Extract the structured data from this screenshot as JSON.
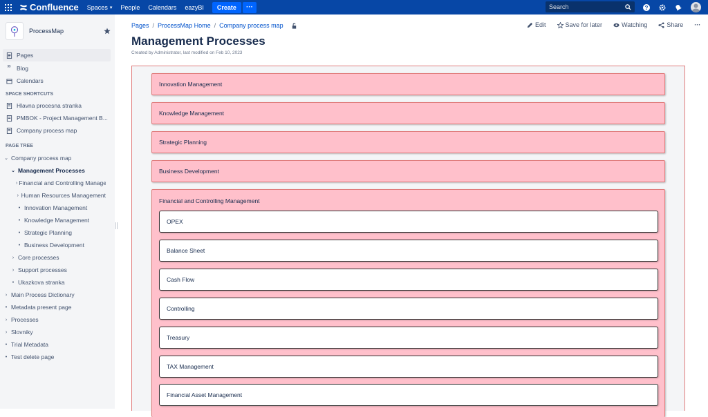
{
  "topnav": {
    "brand": "Confluence",
    "items": [
      "Spaces",
      "People",
      "Calendars",
      "eazyBI"
    ],
    "create_label": "Create",
    "more_label": "···",
    "search_placeholder": "Search"
  },
  "sidebar": {
    "space_name": "ProcessMap",
    "nav": [
      "Pages",
      "Blog",
      "Calendars"
    ],
    "shortcuts_header": "SPACE SHORTCUTS",
    "shortcuts": [
      "Hlavna procesna stranka",
      "PMBOK - Project Management B...",
      "Company process map"
    ],
    "tree_header": "PAGE TREE",
    "tree": [
      {
        "label": "Company process map",
        "toggle": "⌄"
      },
      {
        "label": "Management Processes",
        "toggle": "⌄"
      },
      {
        "label": "Financial and Controlling Management",
        "toggle": "›"
      },
      {
        "label": "Human Resources Management",
        "toggle": "›"
      },
      {
        "label": "Innovation Management",
        "toggle": "•"
      },
      {
        "label": "Knowledge Management",
        "toggle": "•"
      },
      {
        "label": "Strategic Planning",
        "toggle": "•"
      },
      {
        "label": "Business Development",
        "toggle": "•"
      },
      {
        "label": "Core processes",
        "toggle": "›"
      },
      {
        "label": "Support processes",
        "toggle": "›"
      },
      {
        "label": "Ukazkova stranka",
        "toggle": "•"
      },
      {
        "label": "Main Process Dictionary",
        "toggle": "›"
      },
      {
        "label": "Metadata present page",
        "toggle": "•"
      },
      {
        "label": "Processes",
        "toggle": "›"
      },
      {
        "label": "Slovniky",
        "toggle": "›"
      },
      {
        "label": "Trial Metadata",
        "toggle": "•"
      },
      {
        "label": "Test delete page",
        "toggle": "•"
      }
    ]
  },
  "page": {
    "breadcrumb": [
      "Pages",
      "ProcessMap Home",
      "Company process map"
    ],
    "title": "Management Processes",
    "byline": "Created by Administrator, last modified on Feb 10, 2023",
    "actions": {
      "edit": "Edit",
      "save_later": "Save for later",
      "watching": "Watching",
      "share": "Share",
      "more": "···"
    }
  },
  "processes": [
    "Innovation Management",
    "Knowledge Management",
    "Strategic Planning",
    "Business Development",
    "Financial and Controlling Management"
  ],
  "subprocesses": [
    "OPEX",
    "Balance Sheet",
    "Cash Flow",
    "Controlling",
    "Treasury",
    "TAX Management",
    "Financial Asset Management"
  ]
}
